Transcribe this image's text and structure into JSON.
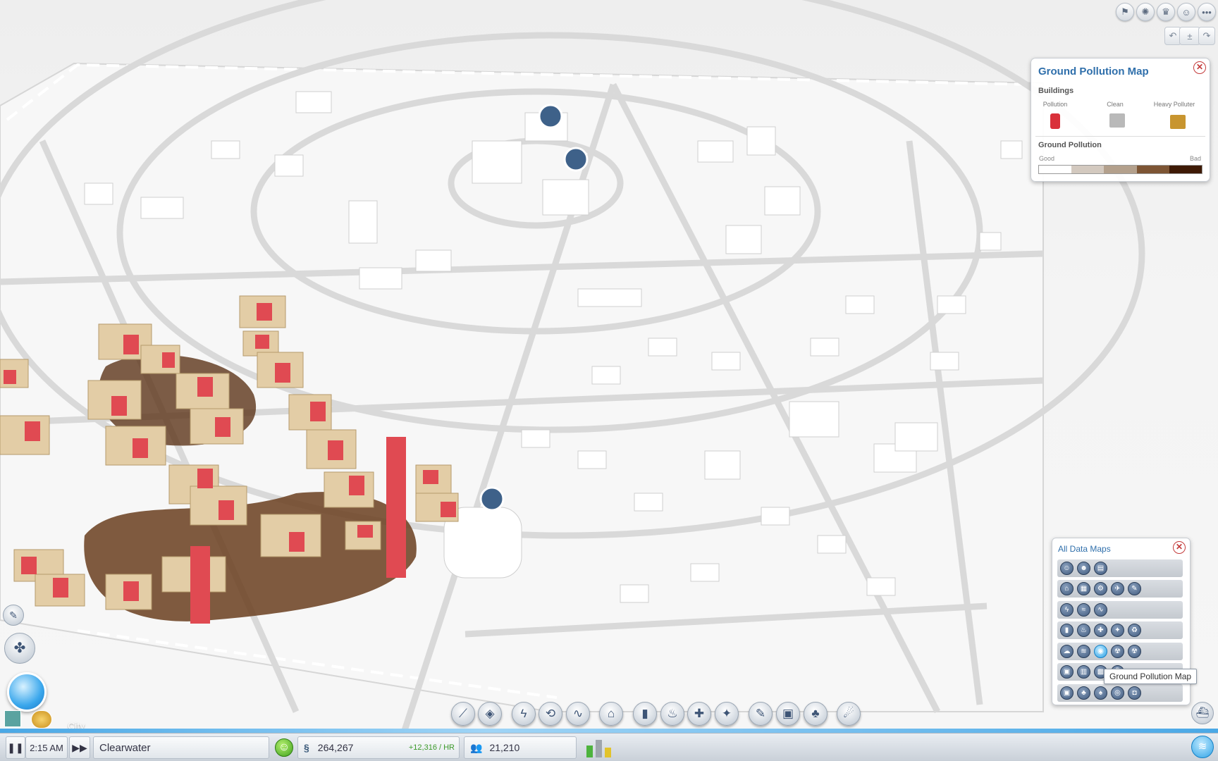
{
  "topbar": {
    "icons": [
      "ribbon-icon",
      "region-icon",
      "trophy-icon",
      "friends-icon",
      "more-icon"
    ],
    "camera": [
      "rotate-left-icon",
      "zoom-icon",
      "rotate-right-icon"
    ]
  },
  "legend": {
    "title": "Ground Pollution Map",
    "buildings_header": "Buildings",
    "buildings": [
      {
        "label": "Pollution",
        "color": "#d9303a"
      },
      {
        "label": "Clean",
        "color": "#b9b9b9"
      },
      {
        "label": "Heavy Polluter",
        "color": "#c8952f"
      }
    ],
    "scale_header": "Ground Pollution",
    "scale_good": "Good",
    "scale_bad": "Bad",
    "scale_colors": [
      "#ffffff",
      "#d3c9bf",
      "#b3a08c",
      "#7d5534",
      "#3e1a05"
    ]
  },
  "data_maps": {
    "title": "All Data Maps",
    "rows": [
      [
        "population-icon",
        "happiness-icon",
        "land-value-icon"
      ],
      [
        "residential-icon",
        "commercial-icon",
        "industrial-icon",
        "tourism-icon",
        "education-icon"
      ],
      [
        "power-icon",
        "water-icon",
        "sewage-icon"
      ],
      [
        "garbage-icon",
        "fire-icon",
        "health-icon",
        "crime-icon",
        "recycling-icon"
      ],
      [
        "air-pollution-icon",
        "water-pollution-icon",
        "ground-pollution-icon",
        "radiation-icon",
        "radiation-alt-icon"
      ],
      [
        "transit-bus-icon",
        "streetcar-icon",
        "train-icon",
        "ferry-icon"
      ],
      [
        "traffic-icon",
        "parks-icon",
        "gambling-icon",
        "wind-icon",
        "tourist-camera-icon"
      ]
    ],
    "active_row": 4,
    "active_index": 2,
    "tooltip": "Ground Pollution Map"
  },
  "toolbar": {
    "tools": [
      "road-tool",
      "zone-tool",
      "power-tool",
      "water-tool",
      "sewage-tool",
      "city-hall-tool",
      "garbage-tool",
      "fire-tool",
      "health-tool",
      "police-tool",
      "education-tool",
      "transit-tool",
      "parks-tool",
      "disaster-tool"
    ]
  },
  "status": {
    "zone_mode": "City",
    "time": "2:15 AM",
    "city_name": "Clearwater",
    "funds": "264,267",
    "income": "+12,316 / HR",
    "population": "21,210",
    "rci": {
      "residential": 0.6,
      "commercial": 0.9,
      "industrial": 0.5
    }
  }
}
